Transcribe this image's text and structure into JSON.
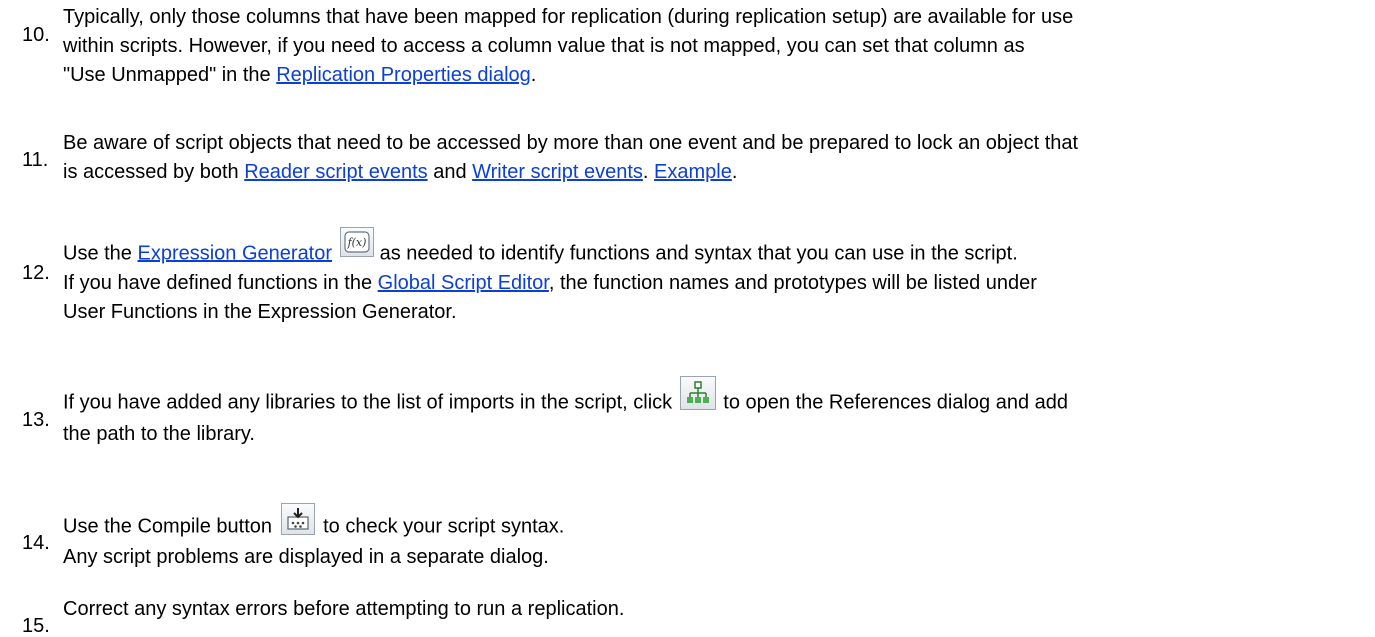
{
  "steps": [
    {
      "number": "10.",
      "p1": "Typically, only those columns that have been mapped for replication (during replication setup) are available for use",
      "p2": "within scripts. However, if you need to access a column value that is not mapped, you can set that column as",
      "p3a": "\"Use Unmapped\" in the ",
      "link": "Replication Properties dialog",
      "p3b": "."
    },
    {
      "number": "11.",
      "p1": "Be aware of script objects that need to be accessed by more than one event and be prepared to lock an object that",
      "p2a": "is accessed by both ",
      "link1": "Reader script events",
      "p2b": " and ",
      "link2": "Writer script events",
      "p2c": ". ",
      "link3": "Example",
      "p2d": "."
    },
    {
      "number": "12.",
      "p1a": "Use the ",
      "link1": "Expression Generator",
      "icon": "function-icon",
      "p1b": " as needed to identify functions and syntax that you can use in the script.",
      "p2a": " If you have defined functions in the ",
      "link2": "Global Script Editor",
      "p2b": ", the function names and prototypes will be listed under",
      "p3": "User Functions in the Expression Generator."
    },
    {
      "number": "13.",
      "p1a": "If you have added any libraries to the list of imports in the script, click ",
      "icon": "references-icon",
      "p1b": " to open the References dialog and add",
      "p2": "the path to the library."
    },
    {
      "number": "14.",
      "p1a": "Use the Compile button ",
      "icon": "compile-icon",
      "p1b": " to check your script syntax.",
      "p2": " Any script problems are displayed in a separate dialog."
    },
    {
      "number": "15.",
      "p1": "Correct any syntax errors before attempting to run a replication."
    }
  ],
  "colors": {
    "link": "#0b3fd6",
    "text": "#000000"
  }
}
